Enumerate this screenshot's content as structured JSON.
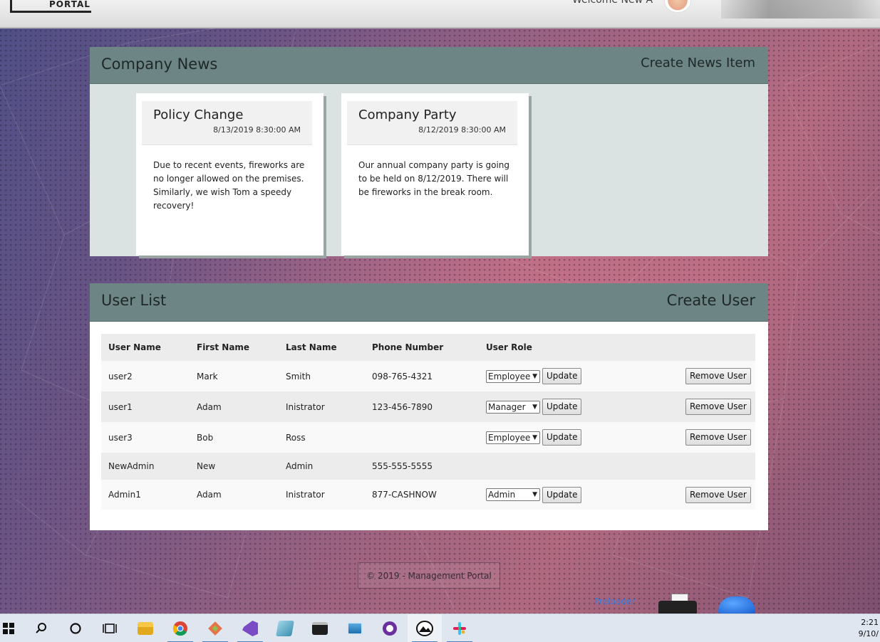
{
  "header": {
    "logo_text": "PORTAL",
    "welcome_text": "Welcome New A"
  },
  "news": {
    "title": "Company News",
    "create_label": "Create News Item",
    "items": [
      {
        "title": "Policy Change",
        "date": "8/13/2019 8:30:00 AM",
        "body": "Due to recent events, fireworks are no longer allowed on the premises. Similarly, we wish Tom a speedy recovery!"
      },
      {
        "title": "Company Party",
        "date": "8/12/2019 8:30:00 AM",
        "body": "Our annual company party is going to be held on 8/12/2019. There will be fireworks in the break room."
      }
    ]
  },
  "users": {
    "title": "User List",
    "create_label": "Create User",
    "columns": [
      "User Name",
      "First Name",
      "Last Name",
      "Phone Number",
      "User Role"
    ],
    "update_label": "Update",
    "remove_label": "Remove User",
    "rows": [
      {
        "username": "user2",
        "first": "Mark",
        "last": "Smith",
        "phone": "098-765-4321",
        "role": "Employee"
      },
      {
        "username": "user1",
        "first": "Adam",
        "last": "Inistrator",
        "phone": "123-456-7890",
        "role": "Manager"
      },
      {
        "username": "user3",
        "first": "Bob",
        "last": "Ross",
        "phone": "",
        "role": "Employee"
      },
      {
        "username": "NewAdmin",
        "first": "New",
        "last": "Admin",
        "phone": "555-555-5555",
        "role": ""
      },
      {
        "username": "Admin1",
        "first": "Adam",
        "last": "Inistrator",
        "phone": "877-CASHNOW",
        "role": "Admin"
      }
    ]
  },
  "footer": {
    "text": "© 2019 - Management Portal"
  },
  "desktop": {
    "preloader_label": "Preloader"
  },
  "taskbar": {
    "icons": [
      "windows-start-icon",
      "search-icon",
      "cortana-icon",
      "task-view-icon",
      "file-explorer-icon",
      "chrome-icon",
      "git-icon",
      "visual-studio-icon",
      "notes-icon",
      "terminal-icon",
      "control-panel-icon",
      "media-icon",
      "photos-icon",
      "slack-icon"
    ],
    "clock_time": "2:21",
    "clock_date": "9/10/"
  }
}
